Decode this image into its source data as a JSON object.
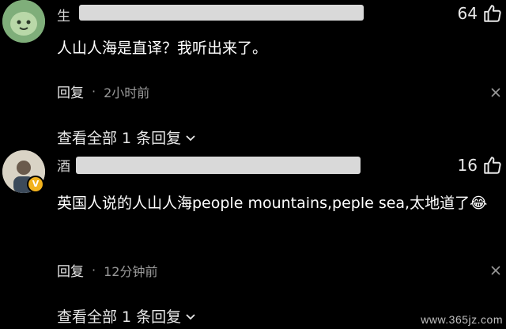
{
  "comments": [
    {
      "username_visible": "生",
      "likes": "64",
      "text": "人山人海是直译？我听出来了。",
      "reply_label": "回复",
      "separator": "·",
      "time": "2小时前",
      "view_replies": "查看全部 1 条回复"
    },
    {
      "username_visible": "酒",
      "likes": "16",
      "text": "英国人说的人山人海people mountains,peple sea,太地道了",
      "emoji": "😂",
      "reply_label": "回复",
      "separator": "·",
      "time": "12分钟前",
      "view_replies": "查看全部 1 条回复",
      "badge": "V"
    }
  ],
  "watermark": "www.365jz.com",
  "colors": {
    "background": "#000000",
    "text": "#ffffff",
    "muted": "#9a9a9a",
    "redaction": "#d9d9d9",
    "avatar1": "#7fae7a",
    "badge": "#f2b21d"
  },
  "icons": [
    "thumbs-up-icon",
    "close-icon",
    "chevron-down-icon",
    "laughing-emoji-icon",
    "verified-badge-icon"
  ]
}
